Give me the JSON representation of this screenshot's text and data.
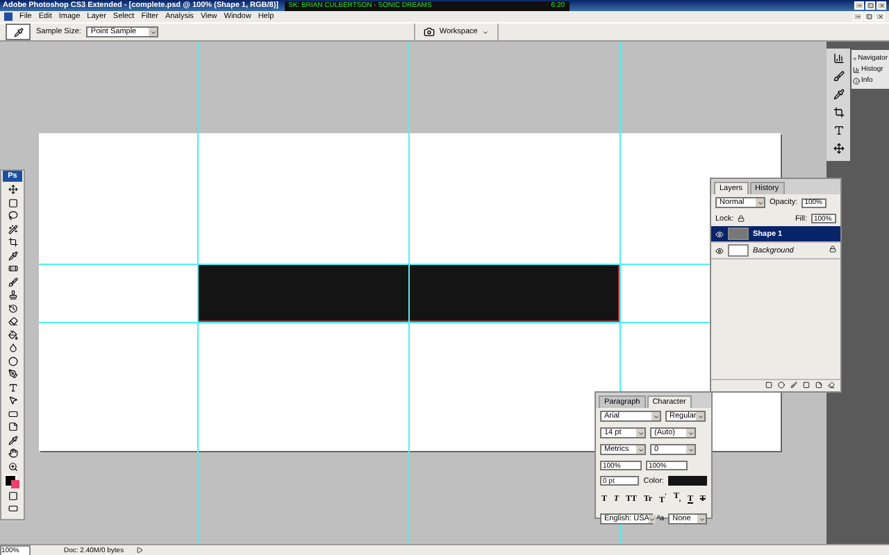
{
  "window": {
    "title": "Adobe Photoshop CS3 Extended - [complete.psd @ 100% (Shape 1, RGB/8)]"
  },
  "player": {
    "track": "SK: BRIAN CULBERTSON - SONIC DREAMS",
    "time": "6:20"
  },
  "menu": [
    "File",
    "Edit",
    "Image",
    "Layer",
    "Select",
    "Filter",
    "Analysis",
    "View",
    "Window",
    "Help"
  ],
  "options": {
    "label": "Sample Size:",
    "value": "Point Sample",
    "workspace": "Workspace"
  },
  "toolbox": {
    "logo": "Ps"
  },
  "dock": [
    "Navigator",
    "Histogr",
    "Info"
  ],
  "layers_panel": {
    "tabs": [
      {
        "label": "Layers",
        "selected": true
      },
      {
        "label": "History",
        "selected": false
      }
    ],
    "blend": "Normal",
    "opacity_label": "Opacity:",
    "opacity": "100%",
    "lock_label": "Lock:",
    "fill_label": "Fill:",
    "fill": "100%",
    "layers": [
      {
        "name": "Shape 1",
        "selected": true,
        "locked": false
      },
      {
        "name": "Background",
        "selected": false,
        "locked": true
      }
    ]
  },
  "character_panel": {
    "tabs": [
      {
        "label": "Paragraph",
        "selected": false
      },
      {
        "label": "Character",
        "selected": true
      }
    ],
    "font": "Arial",
    "style": "Regular",
    "size": "14 pt",
    "leading": "(Auto)",
    "kerning": "Metrics",
    "tracking": "0",
    "vscale": "100%",
    "hscale": "100%",
    "baseline": "0 pt",
    "color_label": "Color:",
    "styles": [
      {
        "kind": "bold",
        "text": "T"
      },
      {
        "kind": "italic",
        "text": "T"
      },
      {
        "kind": "caps",
        "text": "TT"
      },
      {
        "kind": "smallcaps",
        "text": "Tr"
      },
      {
        "kind": "super",
        "text": "T$^{'}$"
      },
      {
        "kind": "sub",
        "text": "T$_{,}$"
      },
      {
        "kind": "underline",
        "text": "T"
      },
      {
        "kind": "strike",
        "text": "T"
      }
    ],
    "language": "English: USA",
    "aa_label": "ªa",
    "antialias": "None"
  },
  "status_bar": {
    "zoom": "100%",
    "doc": "Doc: 2.40M/0 bytes"
  }
}
